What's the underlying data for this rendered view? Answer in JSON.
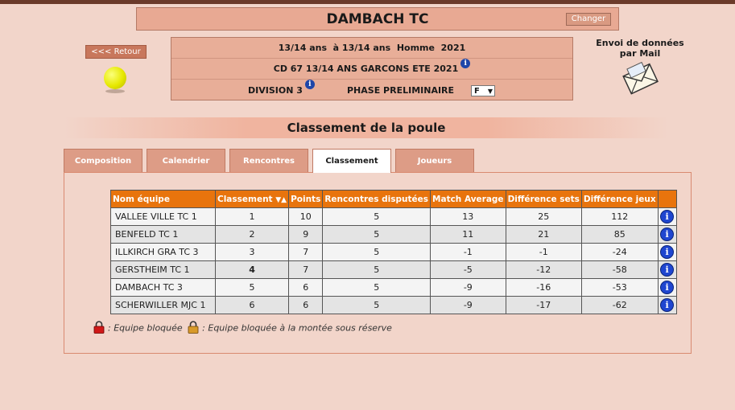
{
  "club": {
    "name": "DAMBACH TC",
    "change_label": "Changer"
  },
  "nav": {
    "back_label": "<<< Retour"
  },
  "competition": {
    "line1": "13/14 ans  à 13/14 ans  Homme  2021",
    "line2": "CD 67 13/14 ANS GARCONS ETE 2021",
    "division": "DIVISION 3",
    "phase": "PHASE PRELIMINAIRE",
    "phase_selected": "F"
  },
  "mail": {
    "title": "Envoi de données par Mail"
  },
  "section": {
    "title": "Classement de la poule"
  },
  "tabs": [
    {
      "label": "Composition",
      "active": false
    },
    {
      "label": "Calendrier",
      "active": false
    },
    {
      "label": "Rencontres",
      "active": false
    },
    {
      "label": "Classement",
      "active": true
    },
    {
      "label": "Joueurs",
      "active": false
    }
  ],
  "table": {
    "headers": [
      "Nom équipe",
      "Classement",
      "Points",
      "Rencontres disputées",
      "Match Average",
      "Différence sets",
      "Différence jeux"
    ],
    "sort_icons": "▼▲",
    "rows": [
      {
        "name": "VALLEE VILLE TC 1",
        "rank": "1",
        "points": "10",
        "played": "5",
        "match_avg": "13",
        "sets": "25",
        "games": "112"
      },
      {
        "name": "BENFELD TC 1",
        "rank": "2",
        "points": "9",
        "played": "5",
        "match_avg": "11",
        "sets": "21",
        "games": "85"
      },
      {
        "name": "ILLKIRCH GRA TC 3",
        "rank": "3",
        "points": "7",
        "played": "5",
        "match_avg": "-1",
        "sets": "-1",
        "games": "-24"
      },
      {
        "name": "GERSTHEIM TC 1",
        "rank": "4",
        "points": "7",
        "played": "5",
        "match_avg": "-5",
        "sets": "-12",
        "games": "-58"
      },
      {
        "name": "DAMBACH TC 3",
        "rank": "5",
        "points": "6",
        "played": "5",
        "match_avg": "-9",
        "sets": "-16",
        "games": "-53"
      },
      {
        "name": "SCHERWILLER MJC 1",
        "rank": "6",
        "points": "6",
        "played": "5",
        "match_avg": "-9",
        "sets": "-17",
        "games": "-62"
      }
    ]
  },
  "legend": {
    "locked": ": Equipe bloquée",
    "locked_promo": ": Equipe bloquée à la montée sous réserve"
  },
  "colors": {
    "header_orange": "#e8740d",
    "background": "#f2d5ca",
    "box": "#e8ae98",
    "info_blue": "#1f46d0"
  },
  "icons": {
    "info": "info-icon",
    "ball": "tennis-ball-icon",
    "mail": "envelope-icon",
    "lock_red": "lock-red-icon",
    "lock_orange": "lock-orange-icon"
  }
}
